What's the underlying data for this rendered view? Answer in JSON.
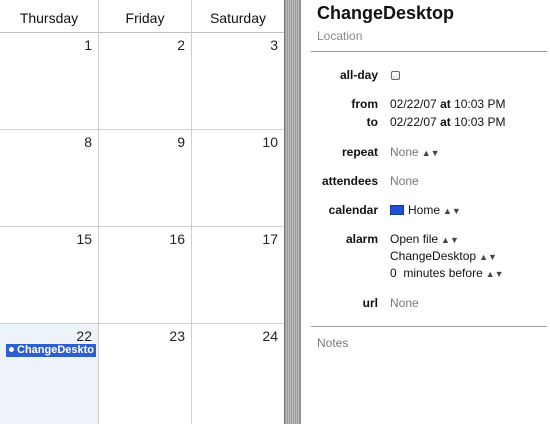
{
  "calendar": {
    "day_headers": [
      "Thursday",
      "Friday",
      "Saturday"
    ],
    "weeks": [
      [
        "1",
        "2",
        "3"
      ],
      [
        "8",
        "9",
        "10"
      ],
      [
        "15",
        "16",
        "17"
      ],
      [
        "22",
        "23",
        "24"
      ]
    ],
    "event": {
      "title": "ChangeDeskto"
    }
  },
  "inspector": {
    "title": "ChangeDesktop",
    "location_placeholder": "Location",
    "allday": {
      "label": "all-day",
      "checked": false
    },
    "from": {
      "label": "from",
      "date": "02/22/07",
      "at": "at",
      "time": "10:03 PM"
    },
    "to": {
      "label": "to",
      "date": "02/22/07",
      "at": "at",
      "time": "10:03 PM"
    },
    "repeat": {
      "label": "repeat",
      "value": "None"
    },
    "attendees": {
      "label": "attendees",
      "value": "None"
    },
    "calendar": {
      "label": "calendar",
      "value": "Home",
      "color": "#1f4fd6"
    },
    "alarm": {
      "label": "alarm",
      "action": "Open file",
      "file": "ChangeDesktop",
      "offset_value": "0",
      "offset_unit": "minutes before"
    },
    "url": {
      "label": "url",
      "value": "None"
    },
    "notes_placeholder": "Notes"
  }
}
